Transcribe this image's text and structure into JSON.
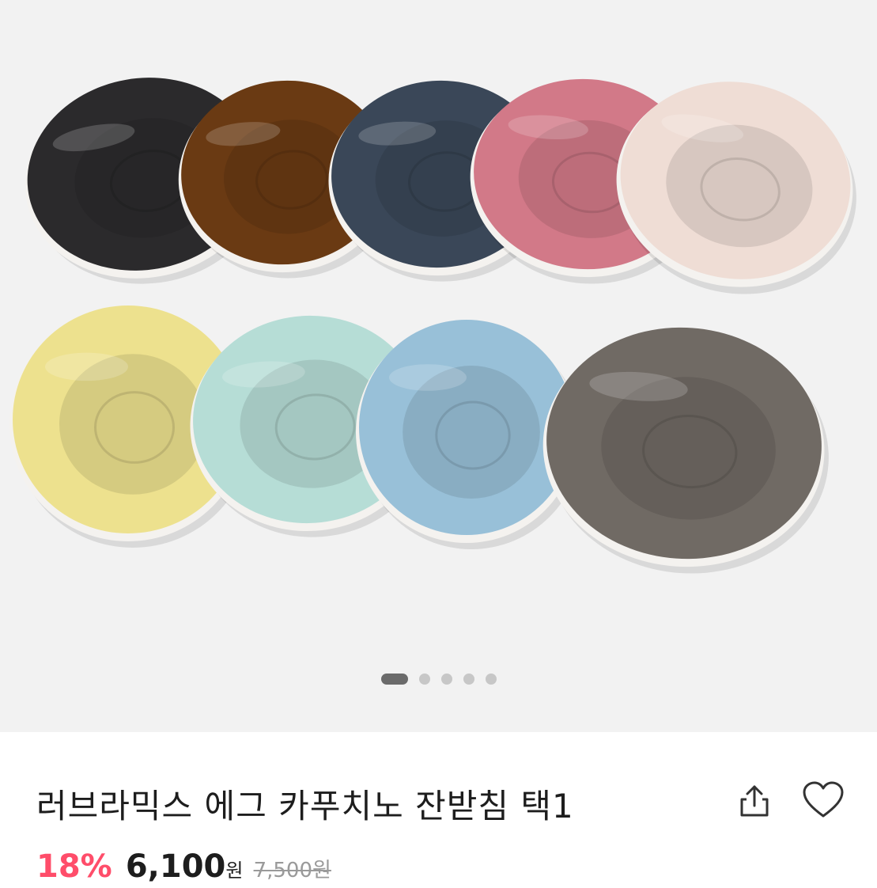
{
  "gallery": {
    "image_alt": "saucers",
    "saucer_colors": [
      "#2b2a2c",
      "#6a3a13",
      "#3a4758",
      "#d27988",
      "#efddd5",
      "#ede18e",
      "#b6ddd6",
      "#98c0d8",
      "#706a64"
    ],
    "carousel": {
      "total": 5,
      "active": 1
    }
  },
  "product": {
    "title": "러브라믹스 에그 카푸치노 잔받침 택1",
    "discount": "18%",
    "price": "6,100",
    "price_unit": "원",
    "original_price": "7,500원"
  },
  "actions": {
    "share_icon": "share-icon",
    "like_icon": "heart-icon"
  },
  "colors": {
    "discount": "#ff4d6a",
    "text": "#1d1d1d"
  }
}
